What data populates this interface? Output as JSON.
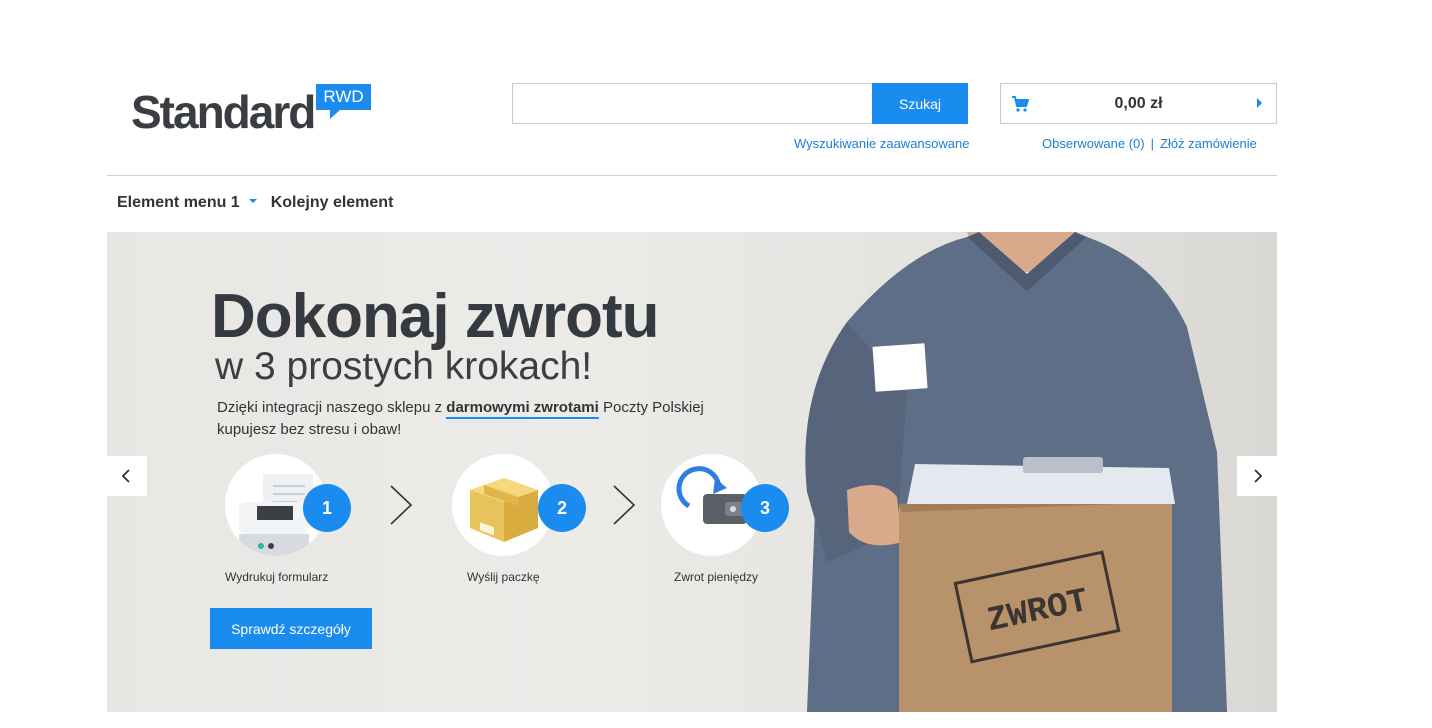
{
  "header": {
    "logo_text": "Standard",
    "logo_badge": "RWD",
    "search": {
      "placeholder": "",
      "button_label": "Szukaj",
      "advanced_link": "Wyszukiwanie zaawansowane"
    },
    "cart": {
      "total": "0,00 zł"
    },
    "links": {
      "watched": "Obserwowane (0)",
      "separator": "|",
      "place_order": "Złóż zamówienie"
    }
  },
  "menu": {
    "items": [
      "Element menu 1",
      "Kolejny element"
    ]
  },
  "banner": {
    "title": "Dokonaj zwrotu",
    "subtitle": "w 3 prostych krokach!",
    "desc_part1": "Dzięki integracji naszego sklepu z ",
    "desc_bold": "darmowymi zwrotami",
    "desc_part2": " Poczty Polskiej",
    "desc_line2": "kupujesz bez stresu i obaw!",
    "steps": [
      {
        "number": "1",
        "label": "Wydrukuj formularz",
        "icon": "printer-icon"
      },
      {
        "number": "2",
        "label": "Wyślij paczkę",
        "icon": "package-icon"
      },
      {
        "number": "3",
        "label": "Zwrot pieniędzy",
        "icon": "wallet-refund-icon"
      }
    ],
    "button_label": "Sprawdź szczegóły",
    "stamp_text": "ZWROT"
  },
  "colors": {
    "accent": "#1a8cef",
    "text_dark": "#353a40"
  }
}
